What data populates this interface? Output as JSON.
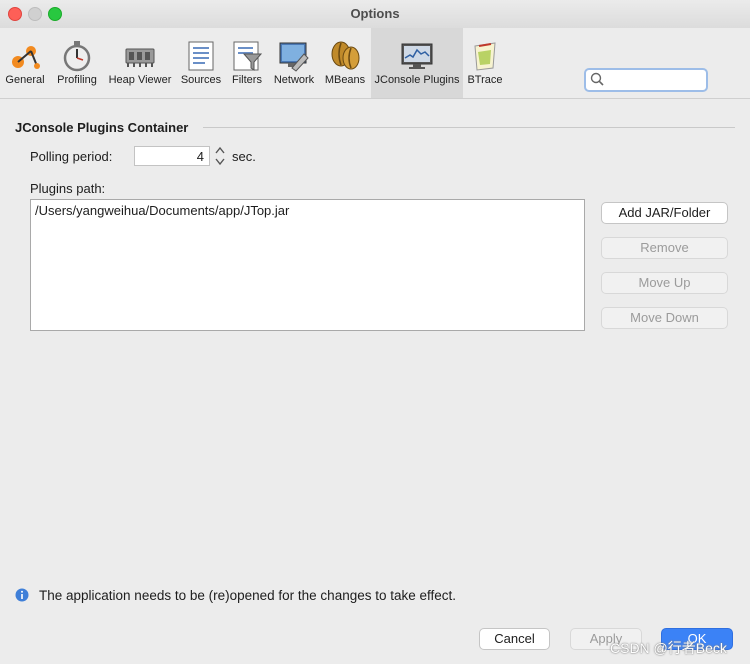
{
  "window": {
    "title": "Options"
  },
  "toolbar": {
    "tabs": [
      {
        "label": "General",
        "icon": "general-icon"
      },
      {
        "label": "Profiling",
        "icon": "stopwatch-icon"
      },
      {
        "label": "Heap Viewer",
        "icon": "memory-chip-icon"
      },
      {
        "label": "Sources",
        "icon": "document-list-icon"
      },
      {
        "label": "Filters",
        "icon": "funnel-icon"
      },
      {
        "label": "Network",
        "icon": "network-wrench-icon"
      },
      {
        "label": "MBeans",
        "icon": "coffee-beans-icon"
      },
      {
        "label": "JConsole Plugins",
        "icon": "jconsole-monitor-icon"
      },
      {
        "label": "BTrace",
        "icon": "btrace-icon"
      }
    ],
    "selected_tab": "JConsole Plugins"
  },
  "search": {
    "value": "",
    "placeholder": ""
  },
  "section": {
    "title": "JConsole Plugins Container"
  },
  "polling": {
    "label": "Polling period:",
    "value": "4",
    "unit": "sec."
  },
  "plugins": {
    "label": "Plugins path:",
    "items": [
      "/Users/yangweihua/Documents/app/JTop.jar"
    ]
  },
  "actions": {
    "add": "Add JAR/Folder",
    "remove": "Remove",
    "move_up": "Move Up",
    "move_down": "Move Down"
  },
  "info": {
    "message": "The application needs to be (re)opened for the changes to take effect."
  },
  "footer": {
    "cancel": "Cancel",
    "apply": "Apply",
    "ok": "OK"
  },
  "watermark": "CSDN @行者Beck",
  "colors": {
    "accent": "#3b82f6",
    "close": "#fe5f57",
    "maximize": "#28c840",
    "info": "#3f7fd8"
  }
}
